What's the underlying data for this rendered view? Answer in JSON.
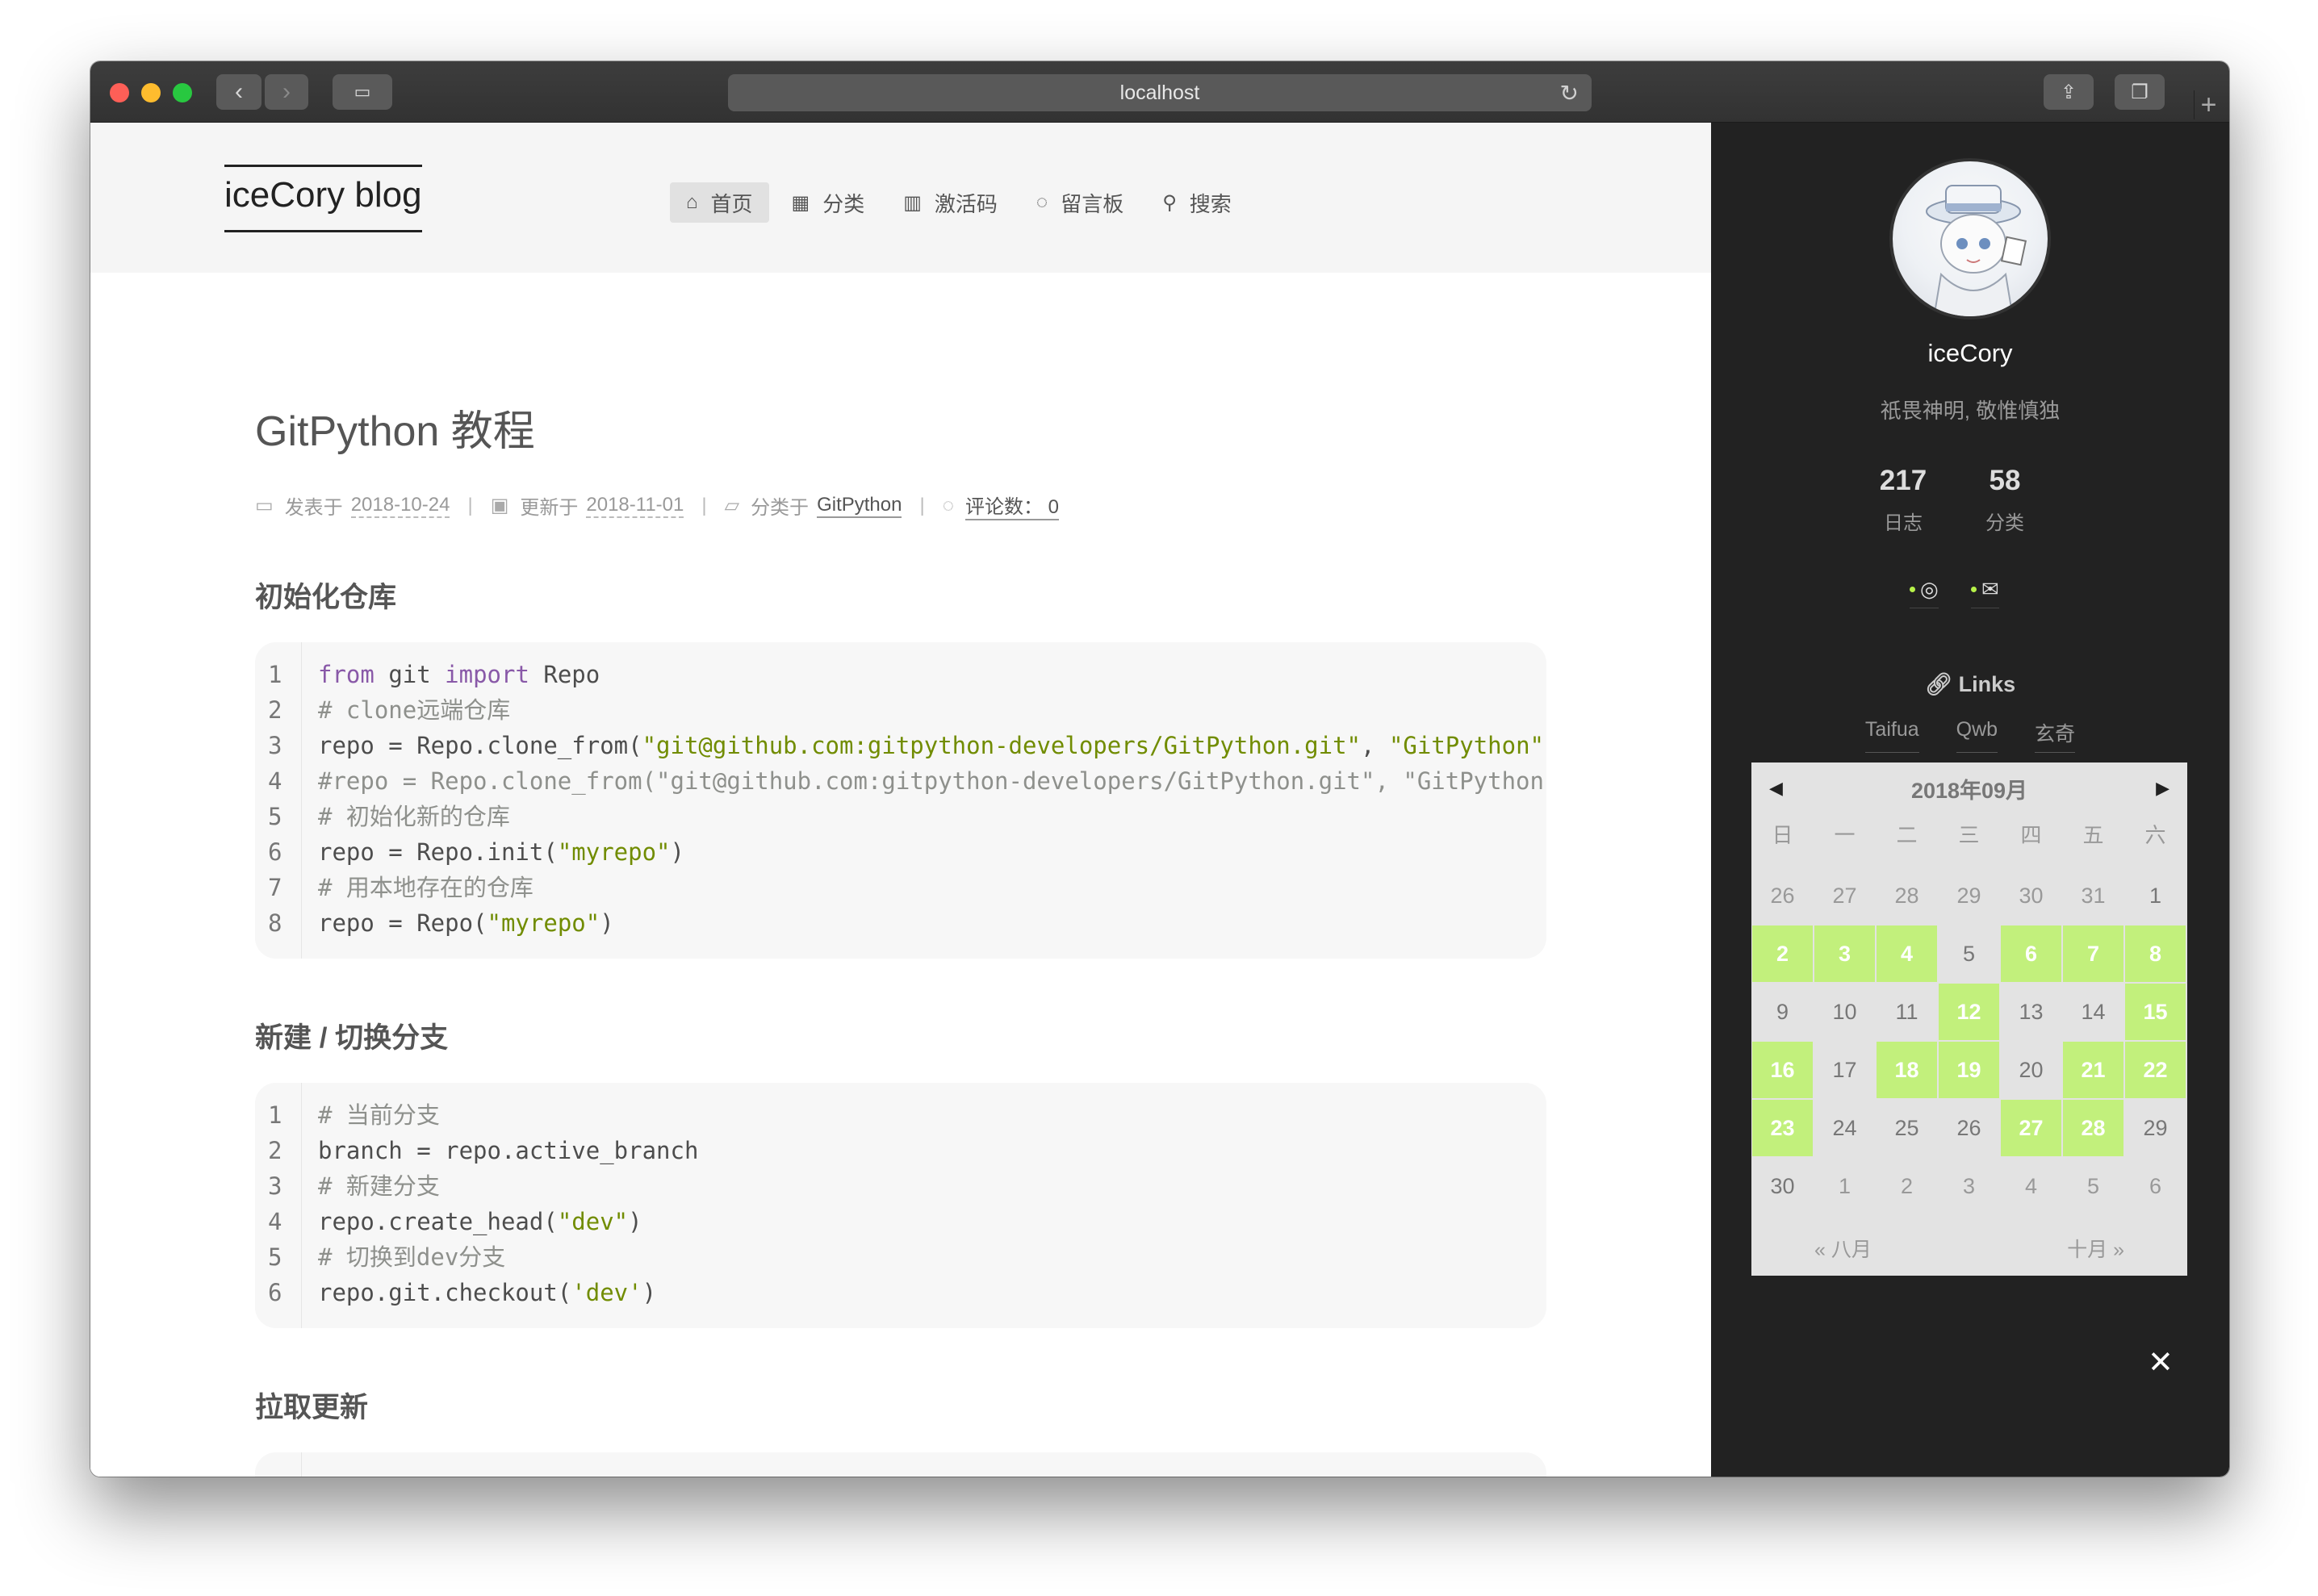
{
  "browser": {
    "url": "localhost",
    "reload_icon": "↻",
    "plus": "+"
  },
  "site": {
    "brand": "iceCory blog",
    "nav": [
      {
        "icon": "home-icon",
        "glyph": "⌂",
        "label": "首页",
        "active": true
      },
      {
        "icon": "grid-icon",
        "glyph": "▦",
        "label": "分类"
      },
      {
        "icon": "barcode-icon",
        "glyph": "▥",
        "label": "激活码"
      },
      {
        "icon": "comment-icon",
        "glyph": "◌",
        "label": "留言板"
      },
      {
        "icon": "search-icon",
        "glyph": "⚲",
        "label": "搜索"
      }
    ]
  },
  "post": {
    "title": "GitPython 教程",
    "meta": {
      "posted_label": "发表于",
      "posted_date": "2018-10-24",
      "updated_label": "更新于",
      "updated_date": "2018-11-01",
      "category_label": "分类于",
      "category": "GitPython",
      "comments_label": "评论数：",
      "comments": "0"
    },
    "sections": [
      {
        "heading": "初始化仓库",
        "code": [
          [
            [
              "kw",
              "from"
            ],
            [
              "",
              "",
              " "
            ],
            [
              "",
              "git "
            ],
            [
              "kw",
              "import"
            ],
            [
              "",
              " Repo"
            ]
          ],
          [
            [
              "cm",
              "# clone远端仓库"
            ]
          ],
          [
            [
              "",
              "repo = Repo.clone_from("
            ],
            [
              "st",
              "\"git@github.com:gitpython-developers/GitPython.git\""
            ],
            [
              "",
              ", "
            ],
            [
              "st",
              "\"GitPython\""
            ],
            [
              "",
              ")"
            ]
          ],
          [
            [
              "cm",
              "#repo = Repo.clone_from(\"git@github.com:gitpython-developers/GitPython.git\", \"GitPython\", b"
            ]
          ],
          [
            [
              "cm",
              "# 初始化新的仓库"
            ]
          ],
          [
            [
              "",
              "repo = Repo.init("
            ],
            [
              "st",
              "\"myrepo\""
            ],
            [
              "",
              ")"
            ]
          ],
          [
            [
              "cm",
              "# 用本地存在的仓库"
            ]
          ],
          [
            [
              "",
              "repo = Repo("
            ],
            [
              "st",
              "\"myrepo\""
            ],
            [
              "",
              ")"
            ]
          ]
        ]
      },
      {
        "heading": "新建 / 切换分支",
        "code": [
          [
            [
              "cm",
              "# 当前分支"
            ]
          ],
          [
            [
              "",
              "branch = repo.active_branch"
            ]
          ],
          [
            [
              "cm",
              "# 新建分支"
            ]
          ],
          [
            [
              "",
              "repo.create_head("
            ],
            [
              "st",
              "\"dev\""
            ],
            [
              "",
              ")"
            ]
          ],
          [
            [
              "cm",
              "# 切换到dev分支"
            ]
          ],
          [
            [
              "",
              "repo.git.checkout("
            ],
            [
              "st",
              "'dev'"
            ],
            [
              "",
              ")"
            ]
          ]
        ]
      },
      {
        "heading": "拉取更新",
        "code": []
      }
    ]
  },
  "sidebar": {
    "name": "iceCory",
    "motto": "祇畏神明, 敬惟慎独",
    "stats": [
      {
        "value": "217",
        "label": "日志"
      },
      {
        "value": "58",
        "label": "分类"
      }
    ],
    "social": [
      {
        "icon": "github-icon",
        "glyph": "◎"
      },
      {
        "icon": "mail-icon",
        "glyph": "✉"
      }
    ],
    "links_title": "Links",
    "links": [
      "Taifua",
      "Qwb",
      "玄奇"
    ],
    "calendar": {
      "month": "2018年09月",
      "prev_arrow": "◀",
      "next_arrow": "▶",
      "weekdays": [
        "日",
        "一",
        "二",
        "三",
        "四",
        "五",
        "六"
      ],
      "weeks": [
        [
          "26",
          "27",
          "28",
          "29",
          "30",
          "31",
          "1"
        ],
        [
          "2",
          "3",
          "4",
          "5",
          "6",
          "7",
          "8"
        ],
        [
          "9",
          "10",
          "11",
          "12",
          "13",
          "14",
          "15"
        ],
        [
          "16",
          "17",
          "18",
          "19",
          "20",
          "21",
          "22"
        ],
        [
          "23",
          "24",
          "25",
          "26",
          "27",
          "28",
          "29"
        ],
        [
          "30",
          "1",
          "2",
          "3",
          "4",
          "5",
          "6"
        ]
      ],
      "highlighted": [
        "2",
        "3",
        "4",
        "6",
        "7",
        "8",
        "12",
        "15",
        "16",
        "18",
        "19",
        "21",
        "22",
        "23",
        "27",
        "28"
      ],
      "prev_month": "« 八月",
      "next_month": "十月 »"
    },
    "close": "✕"
  }
}
